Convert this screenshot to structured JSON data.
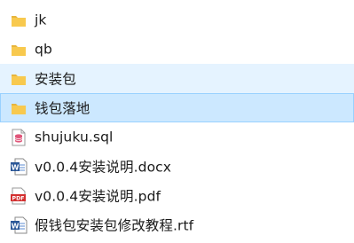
{
  "items": [
    {
      "name": "jk",
      "type": "folder",
      "icon": "folder-icon",
      "state": "normal"
    },
    {
      "name": "qb",
      "type": "folder",
      "icon": "folder-icon",
      "state": "normal"
    },
    {
      "name": "安装包",
      "type": "folder",
      "icon": "folder-icon",
      "state": "hover"
    },
    {
      "name": "钱包落地",
      "type": "folder",
      "icon": "folder-icon",
      "state": "selected"
    },
    {
      "name": "shujuku.sql",
      "type": "sql",
      "icon": "database-file-icon",
      "state": "normal"
    },
    {
      "name": "v0.0.4安装说明.docx",
      "type": "docx",
      "icon": "word-document-icon",
      "state": "normal"
    },
    {
      "name": "v0.0.4安装说明.pdf",
      "type": "pdf",
      "icon": "pdf-document-icon",
      "state": "normal"
    },
    {
      "name": "假钱包安装包修改教程.rtf",
      "type": "rtf",
      "icon": "rtf-document-icon",
      "state": "normal"
    }
  ],
  "colors": {
    "hover_bg": "#e5f3ff",
    "selected_bg": "#cce8ff",
    "selected_border": "#99d1ff",
    "folder": "#f8c94e",
    "word_blue": "#2b5797",
    "pdf_red": "#d32f2f",
    "db_pink": "#e0567a"
  }
}
